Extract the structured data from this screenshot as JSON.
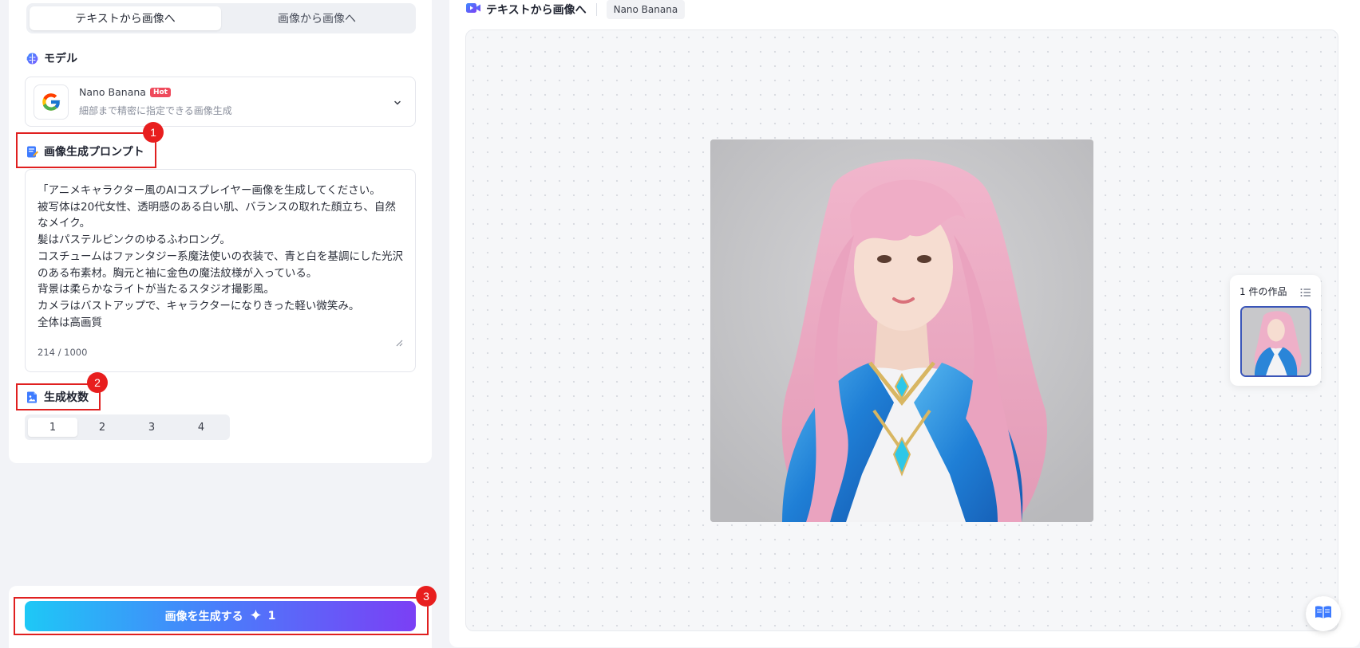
{
  "mode_tabs": [
    {
      "label": "テキストから画像へ",
      "active": true
    },
    {
      "label": "画像から画像へ",
      "active": false
    }
  ],
  "model_section": {
    "title": "モデル",
    "selected_model": {
      "name": "Nano Banana",
      "badge": "Hot",
      "description": "細部まで精密に指定できる画像生成",
      "icon": "google-logo-icon"
    }
  },
  "prompt_section": {
    "title": "画像生成プロンプト",
    "value": "「アニメキャラクター風のAIコスプレイヤー画像を生成してください。\n被写体は20代女性、透明感のある白い肌、バランスの取れた顔立ち、自然なメイク。\n髪はパステルピンクのゆるふわロング。\nコスチュームはファンタジー系魔法使いの衣装で、青と白を基調にした光沢のある布素材。胸元と袖に金色の魔法紋様が入っている。\n背景は柔らかなライトが当たるスタジオ撮影風。\nカメラはバストアップで、キャラクターになりきった軽い微笑み。\n全体は高画質",
    "char_count": "214 / 1000"
  },
  "count_section": {
    "title": "生成枚数",
    "options": [
      "1",
      "2",
      "3",
      "4"
    ],
    "selected": "1"
  },
  "generate_button": {
    "label": "画像を生成する",
    "credit_icon": "sparkle-icon",
    "credit_cost": "1"
  },
  "annotations": [
    "1",
    "2",
    "3"
  ],
  "result_panel": {
    "title": "テキストから画像へ",
    "title_icon": "video-camera-icon",
    "model_chip": "Nano Banana",
    "works_label": "1 件の作品",
    "works_count": 1
  },
  "colors": {
    "accent_gradient_start": "#1ec8f6",
    "accent_gradient_end": "#7b3ff5",
    "annotation_red": "#e02020",
    "hot_badge": "#ef4a5c"
  }
}
